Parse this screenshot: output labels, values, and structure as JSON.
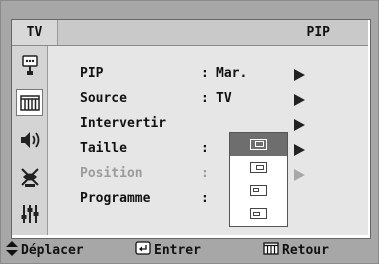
{
  "osd": {
    "tab_label": "TV",
    "title": "PIP",
    "side_icons": [
      "input-icon",
      "picture-icon",
      "sound-icon",
      "channel-antenna-icon",
      "setup-sliders-icon"
    ],
    "rows": [
      {
        "label": "PIP",
        "colon": ":",
        "value": "Mar."
      },
      {
        "label": "Source",
        "colon": ":",
        "value": "TV"
      },
      {
        "label": "Intervertir",
        "colon": "",
        "value": ""
      },
      {
        "label": "Taille",
        "colon": ":",
        "value": ""
      },
      {
        "label": "Position",
        "colon": ":",
        "value": ""
      },
      {
        "label": "Programme",
        "colon": ":",
        "value": ""
      }
    ],
    "size_options": [
      "size-large-icon",
      "size-medium-icon",
      "size-small-icon",
      "size-double-icon"
    ],
    "selected_size_index": 0
  },
  "footer": {
    "move_label": "Déplacer",
    "enter_label": "Entrer",
    "return_label": "Retour"
  },
  "colors": {
    "background": "#a7a7a7",
    "title_bar": "#c9c9c9",
    "menu_bg": "#e6e6e6",
    "selected_option": "#6e6e6e",
    "disabled_text": "#9b9b9b"
  }
}
